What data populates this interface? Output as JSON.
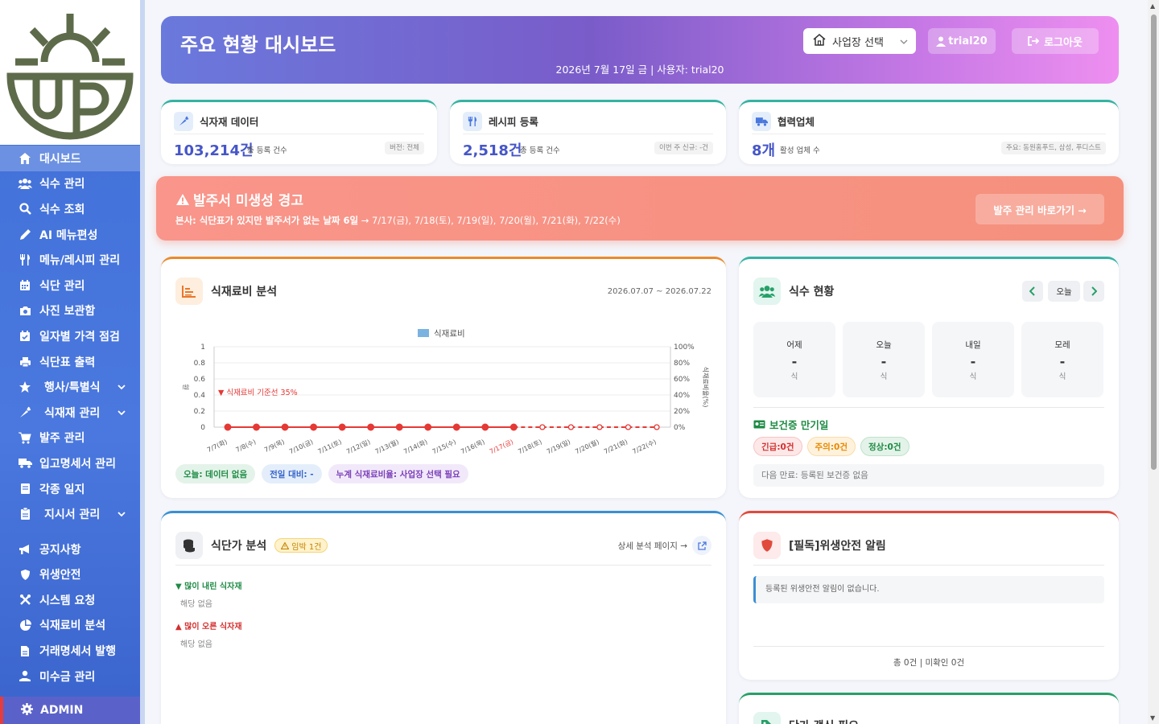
{
  "sidebar": {
    "items": [
      {
        "label": "대시보드",
        "icon": "home-icon",
        "active": true
      },
      {
        "label": "식수 관리",
        "icon": "users-icon"
      },
      {
        "label": "식수 조회",
        "icon": "search-icon"
      },
      {
        "label": "AI 메뉴편성",
        "icon": "pencil-icon"
      },
      {
        "label": "메뉴/레시피 관리",
        "icon": "utensils-icon"
      },
      {
        "label": "식단 관리",
        "icon": "calendar-icon"
      },
      {
        "label": "사진 보관함",
        "icon": "camera-icon"
      },
      {
        "label": "일자별 가격 점검",
        "icon": "calendar-check-icon"
      },
      {
        "label": "식단표 출력",
        "icon": "printer-icon"
      },
      {
        "label": "행사/특별식",
        "icon": "star-icon",
        "expandable": true
      },
      {
        "label": "식재재 관리",
        "icon": "carrot-icon",
        "expandable": true
      },
      {
        "label": "발주 관리",
        "icon": "cart-icon"
      },
      {
        "label": "입고명세서 관리",
        "icon": "truck-icon"
      },
      {
        "label": "각종 일지",
        "icon": "book-icon"
      },
      {
        "label": "지시서 관리",
        "icon": "clipboard-icon",
        "expandable": true
      },
      {
        "label": "공지사항",
        "icon": "megaphone-icon"
      },
      {
        "label": "위생안전",
        "icon": "shield-icon"
      },
      {
        "label": "시스템 요청",
        "icon": "tools-icon"
      },
      {
        "label": "식재료비 분석",
        "icon": "pie-chart-icon"
      },
      {
        "label": "거래명세서 발행",
        "icon": "file-icon"
      },
      {
        "label": "미수금 관리",
        "icon": "hand-coin-icon"
      }
    ],
    "admin_label": "ADMIN"
  },
  "header": {
    "title": "주요 현황 대시보드",
    "subtitle": "2026년 7월 17일 금 | 사용자: trial20",
    "site_select": "사업장 선택",
    "user_label": "trial20",
    "logout_label": "로그아웃"
  },
  "stats": [
    {
      "name": "식자재 데이터",
      "value": "103,214건",
      "desc": "총 등록 건수",
      "tag": "버전: 전체",
      "icon": "carrot-icon"
    },
    {
      "name": "레시피 등록",
      "value": "2,518건",
      "desc": "총 등록 건수",
      "tag": "이번 주 신규: -건",
      "icon": "utensils-icon"
    },
    {
      "name": "협력업체",
      "value": "8개",
      "desc": "활성 업체 수",
      "tag": "주요: 동원홈푸드, 삼성, 푸디스트",
      "icon": "truck-icon"
    }
  ],
  "alert": {
    "title": "발주서 미생성 경고",
    "message_bold": "본사: 식단표가 있지만 발주서가 없는 날짜 6일",
    "message_rest": " → 7/17(금), 7/18(토), 7/19(일), 7/20(월), 7/21(화), 7/22(수)",
    "button": "발주 관리 바로가기 →"
  },
  "cost_panel": {
    "title": "식재료비 분석",
    "range": "2026.07.07 ~ 2026.07.22",
    "chips": [
      "오늘: 데이터 없음",
      "전일 대비: -",
      "누계 식재료비율: 사업장 선택 필요"
    ]
  },
  "chart_data": {
    "type": "line",
    "legend": [
      "식재료비"
    ],
    "categories": [
      "7/7(화)",
      "7/8(수)",
      "7/9(목)",
      "7/10(금)",
      "7/11(토)",
      "7/12(일)",
      "7/13(월)",
      "7/14(화)",
      "7/15(수)",
      "7/16(목)",
      "7/17(금)",
      "7/18(토)",
      "7/19(일)",
      "7/20(월)",
      "7/21(화)",
      "7/22(수)"
    ],
    "series": [
      {
        "name": "식재료비",
        "values": [
          0,
          0,
          0,
          0,
          0,
          0,
          0,
          0,
          0,
          0,
          0,
          0,
          0,
          0,
          0,
          0
        ]
      }
    ],
    "today_index": 10,
    "ylim": [
      0,
      1
    ],
    "yticks": [
      "0",
      "0.2",
      "0.4",
      "0.6",
      "0.8",
      "1"
    ],
    "ylabel_left": "원",
    "y2ticks": [
      "0%",
      "20%",
      "40%",
      "60%",
      "80%",
      "100%"
    ],
    "ylabel_right": "식재료비율(%)",
    "baseline_label": "▼ 식재료비 기준선 35%",
    "colors": {
      "series": "#e53935",
      "legend": "#7ab3e0"
    }
  },
  "meal_panel": {
    "title": "식수 현황",
    "today_btn": "오늘",
    "days": [
      {
        "label": "어제",
        "value": "-",
        "unit": "식"
      },
      {
        "label": "오늘",
        "value": "-",
        "unit": "식"
      },
      {
        "label": "내일",
        "value": "-",
        "unit": "식"
      },
      {
        "label": "모레",
        "value": "-",
        "unit": "식"
      }
    ],
    "health_title": "보건증 만기일",
    "badges": [
      "긴급:0건",
      "주의:0건",
      "정상:0건"
    ],
    "next_expiry": "다음 만료: 등록된 보건증 없음"
  },
  "price_panel": {
    "title": "식단가 분석",
    "badge": "임박 1건",
    "detail_link": "상세 분석 페이지 →",
    "down_title": "▼ 많이 내린 식자재",
    "down_empty": "해당 없음",
    "up_title": "▲ 많이 오른 식자재",
    "up_empty": "해당 없음"
  },
  "safety_panel": {
    "title": "[필독]위생안전 알림",
    "empty": "등록된 위생안전 알림이 없습니다.",
    "footer": "총 0건 | 미확인 0건"
  },
  "bottom_panel": {
    "title": "단가 갱신 필요"
  }
}
